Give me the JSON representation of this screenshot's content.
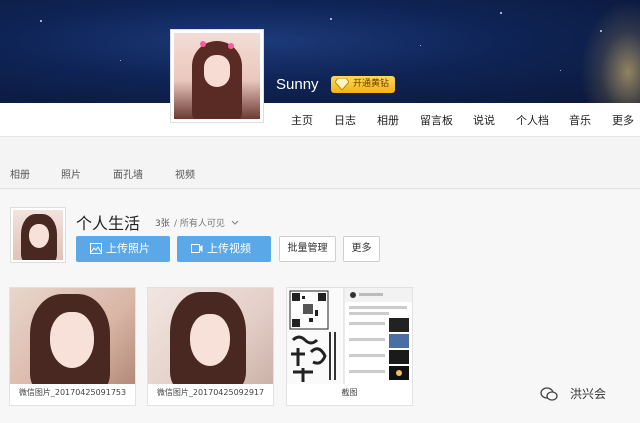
{
  "header": {
    "username": "Sunny",
    "vip_badge": "开通黄钻"
  },
  "nav": {
    "items": [
      {
        "label": "主页"
      },
      {
        "label": "日志"
      },
      {
        "label": "相册"
      },
      {
        "label": "留言板"
      },
      {
        "label": "说说"
      },
      {
        "label": "个人档"
      },
      {
        "label": "音乐"
      },
      {
        "label": "更多"
      }
    ]
  },
  "subtabs": [
    {
      "label": "相册"
    },
    {
      "label": "照片"
    },
    {
      "label": "面孔墙"
    },
    {
      "label": "视频"
    }
  ],
  "album": {
    "title": "个人生活",
    "count": "3张",
    "visibility": "/ 所有人可见"
  },
  "actions": {
    "upload_photo": "上传照片",
    "upload_video": "上传视频",
    "batch_manage": "批量管理",
    "more": "更多"
  },
  "photos": [
    {
      "caption": "微信图片_20170425091753"
    },
    {
      "caption": "微信图片_20170425092917"
    },
    {
      "caption": "截图"
    }
  ],
  "watermark": {
    "text": "洪兴会"
  },
  "colors": {
    "banner": "#0f2456",
    "accent_blue": "#5aa8e8",
    "vip_gold": "#f2b218"
  }
}
